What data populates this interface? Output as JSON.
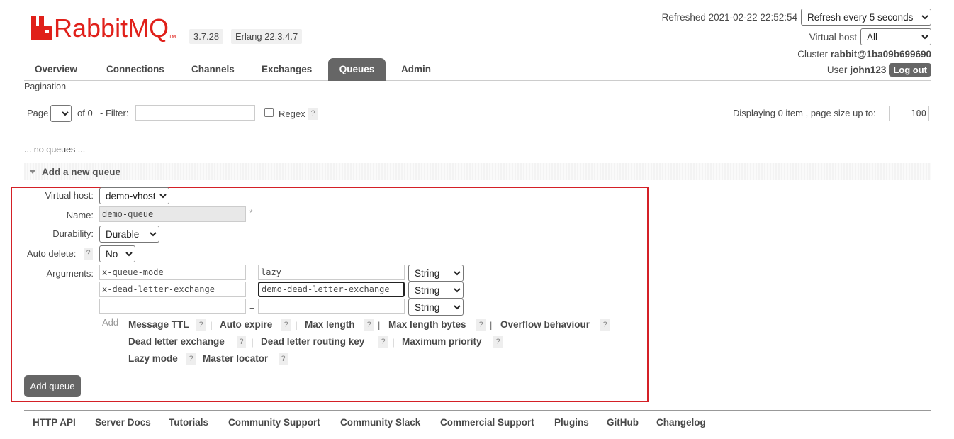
{
  "app": {
    "logo_text": "RabbitMQ",
    "logo_tm": "TM",
    "version": "3.7.28",
    "erlang": "Erlang 22.3.4.7"
  },
  "header": {
    "refreshed": "Refreshed 2021-02-22 22:52:54",
    "refresh_select": "Refresh every 5 seconds",
    "vhost_label": "Virtual host",
    "vhost_select": "All",
    "cluster_label": "Cluster",
    "cluster_name": "rabbit@1ba09b699690",
    "user_label": "User",
    "user_name": "john123",
    "logout_label": "Log out"
  },
  "tabs": [
    "Overview",
    "Connections",
    "Channels",
    "Exchanges",
    "Queues",
    "Admin"
  ],
  "active_tab": "Queues",
  "pagination": {
    "section_label": "Pagination",
    "page_label": "Page",
    "page_value": "",
    "of_label": "of 0",
    "filter_label": "- Filter:",
    "filter_value": "",
    "regex_label": "Regex",
    "help_glyph": "?",
    "displaying": "Displaying 0 item , page size up to:",
    "page_size": "100"
  },
  "empty_message": "... no queues ...",
  "add_queue": {
    "title": "Add a new queue",
    "vhost_label": "Virtual host:",
    "vhost_value": "demo-vhost",
    "name_label": "Name:",
    "name_value": "demo-queue",
    "required_mark": "*",
    "durability_label": "Durability:",
    "durability_value": "Durable",
    "auto_delete_label": "Auto delete:",
    "auto_delete_value": "No",
    "arguments_label": "Arguments:",
    "eq": "=",
    "arguments": [
      {
        "key": "x-queue-mode",
        "value": "lazy",
        "type": "String"
      },
      {
        "key": "x-dead-letter-exchange",
        "value": "demo-dead-letter-exchange",
        "type": "String"
      },
      {
        "key": "",
        "value": "",
        "type": "String"
      }
    ],
    "add_label": "Add",
    "options": {
      "message_ttl": "Message TTL",
      "auto_expire": "Auto expire",
      "max_length": "Max length",
      "max_length_bytes": "Max length bytes",
      "overflow": "Overflow behaviour",
      "dlx": "Dead letter exchange",
      "dlrk": "Dead letter routing key",
      "max_priority": "Maximum priority",
      "lazy_mode": "Lazy mode",
      "master_locator": "Master locator"
    },
    "separator": "|",
    "submit_label": "Add queue"
  },
  "footer": [
    "HTTP API",
    "Server Docs",
    "Tutorials",
    "Community Support",
    "Community Slack",
    "Commercial Support",
    "Plugins",
    "GitHub",
    "Changelog"
  ]
}
